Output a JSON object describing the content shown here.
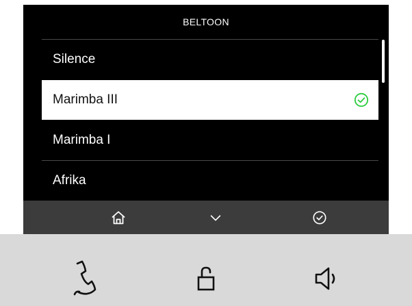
{
  "screen": {
    "title": "BELTOON"
  },
  "ringtones": {
    "items": [
      {
        "label": "Silence",
        "selected": false
      },
      {
        "label": "Marimba III",
        "selected": true
      },
      {
        "label": "Marimba I",
        "selected": false
      },
      {
        "label": "Afrika",
        "selected": false
      }
    ],
    "selected_icon": "check-circle-icon",
    "selected_color": "#2ecc40"
  },
  "scroll": {
    "position_fraction": 0.0,
    "visible_fraction": 0.28
  },
  "nav_bar": {
    "buttons": [
      "home-icon",
      "chevron-down-icon",
      "check-circle-icon"
    ]
  },
  "hardware_panel": {
    "buttons": [
      "handset-icon",
      "unlock-icon",
      "speaker-icon"
    ]
  },
  "colors": {
    "screen_background": "#000000",
    "nav_bar": "#3c3c3c",
    "panel": "#d9d9d9",
    "accent": "#2ecc40"
  }
}
